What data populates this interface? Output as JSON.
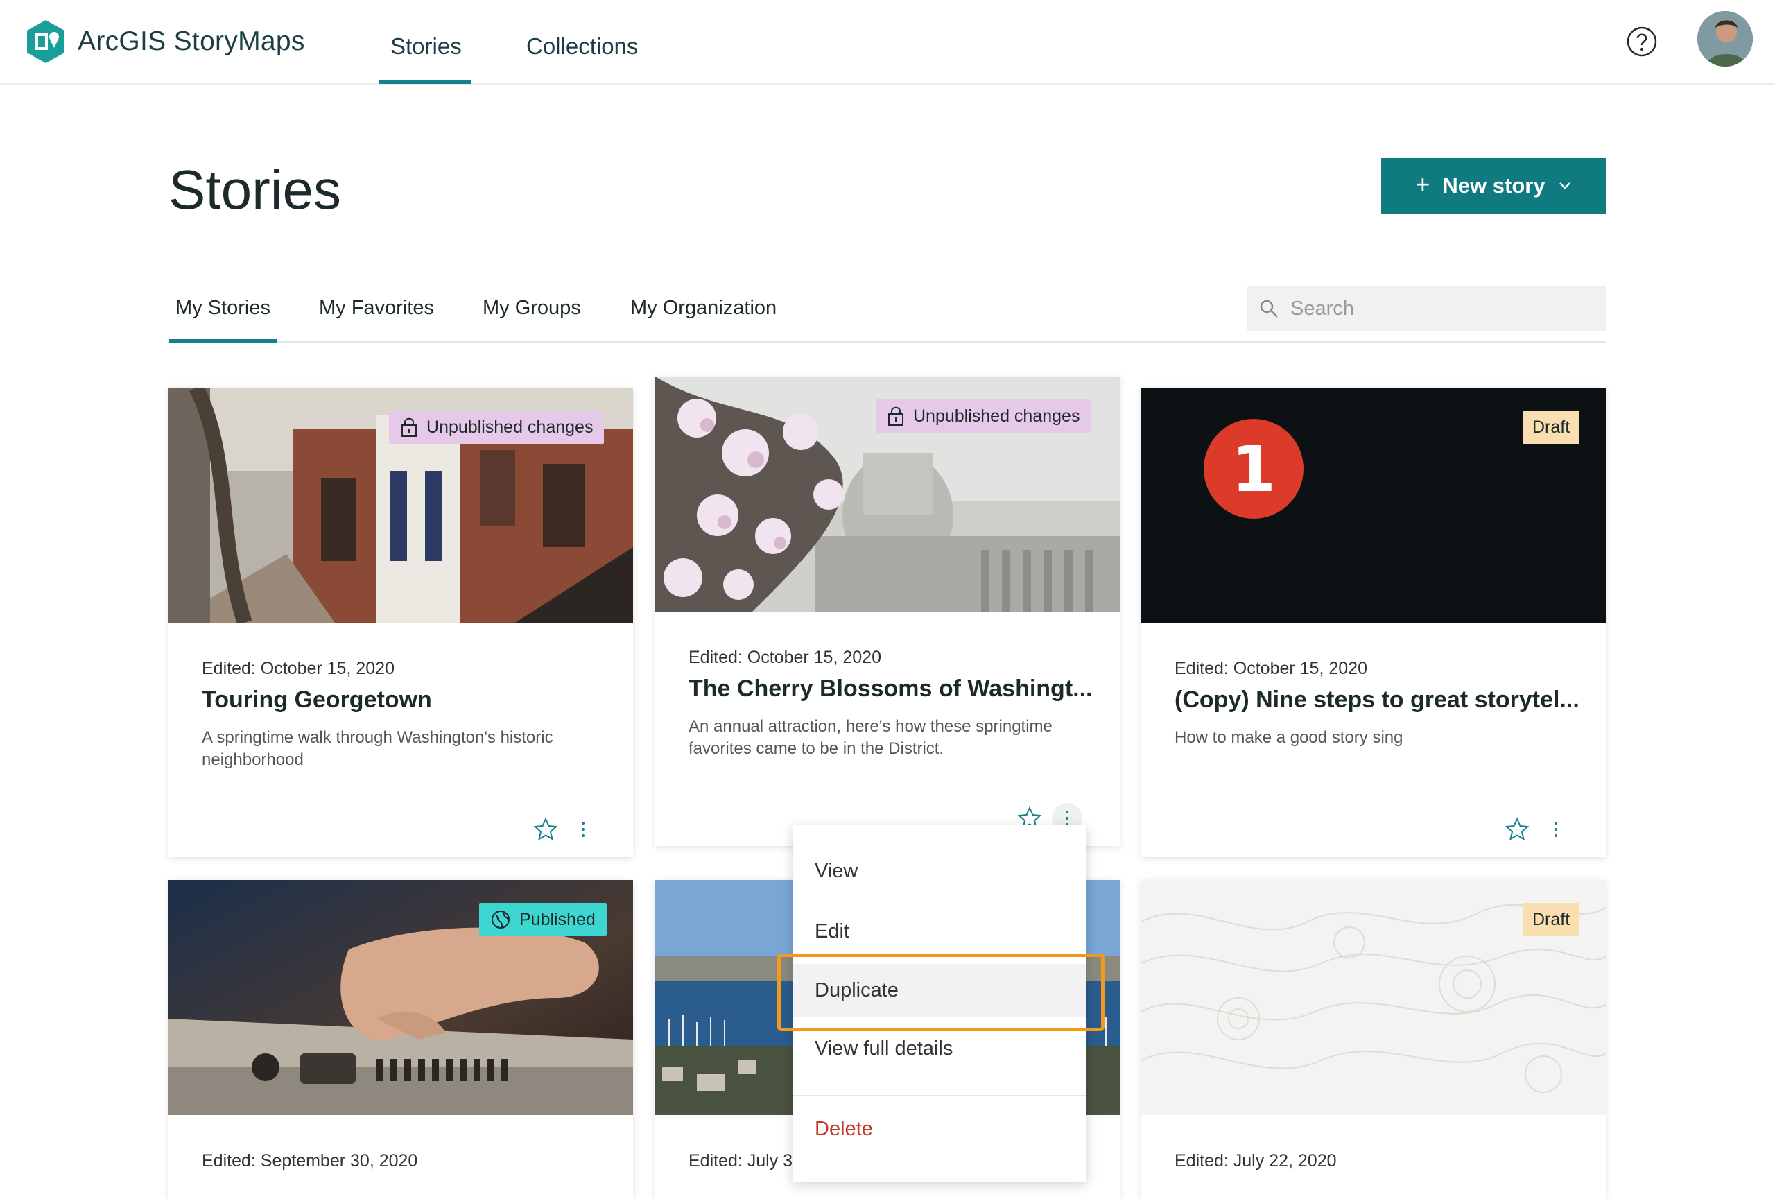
{
  "app": {
    "title": "ArcGIS StoryMaps"
  },
  "nav": {
    "tabs": [
      {
        "label": "Stories"
      },
      {
        "label": "Collections"
      }
    ]
  },
  "page": {
    "title": "Stories",
    "new_story_label": "New story"
  },
  "subtabs": [
    "My Stories",
    "My Favorites",
    "My Groups",
    "My Organization"
  ],
  "search": {
    "placeholder": "Search",
    "value": ""
  },
  "cards": [
    {
      "badge": "Unpublished changes",
      "edited": "Edited: October 15, 2020",
      "title": "Touring Georgetown",
      "description": "A springtime walk through Washington's historic neighborhood"
    },
    {
      "badge": "Unpublished changes",
      "edited": "Edited: October 15, 2020",
      "title": "The Cherry Blossoms of Washingt...",
      "description": "An annual attraction, here's how these springtime favorites came to be in the District."
    },
    {
      "badge": "Draft",
      "thumb_text": "1",
      "edited": "Edited: October 15, 2020",
      "title": "(Copy) Nine steps to great storytel...",
      "description": "How to make a good story sing"
    },
    {
      "badge": "Published",
      "edited": "Edited: September 30, 2020"
    },
    {
      "edited": "Edited: July 3"
    },
    {
      "badge": "Draft",
      "edited": "Edited: July 22, 2020"
    }
  ],
  "context_menu": {
    "items": [
      "View",
      "Edit",
      "Duplicate",
      "View full details",
      "Delete"
    ],
    "highlighted": "Duplicate"
  },
  "colors": {
    "accent": "#17808d",
    "button": "#0f7b80",
    "highlight_box": "#f29a1a",
    "delete": "#c0392b"
  }
}
